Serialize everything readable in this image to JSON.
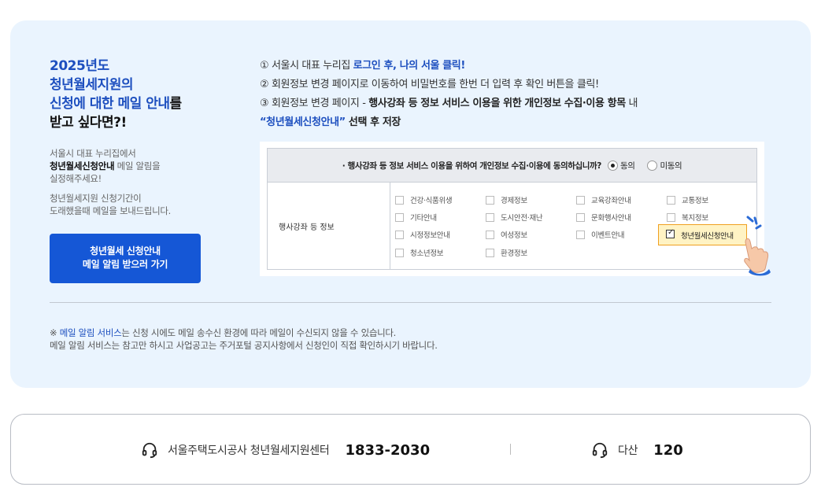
{
  "headline": {
    "line1": "2025년도",
    "line2": "청년월세지원의",
    "line3_blue": "신청에 대한 메일 안내",
    "line3_rest": "를",
    "line4": "받고 싶다면?!"
  },
  "desc1": {
    "line1": "서울시 대표 누리집에서",
    "bold": "청년월세신청안내",
    "line2_rest": " 메일 알림을",
    "line3": "실정해주세요!"
  },
  "desc2": {
    "line1": "청년월세지원 신청기간이",
    "line2": "도래했을때 메일을 보내드립니다."
  },
  "cta": {
    "line1": "청년월세 신청안내",
    "line2": "메일 알림 받으러 가기"
  },
  "steps": {
    "s1_pre": "① 서울시 대표 누리집 ",
    "s1_blue": "로그인 후, 나의 서울 클릭!",
    "s2": "② 회원정보 변경 페이지로 이동하여 비밀번호를 한번 더 입력 후 확인 버튼을 클릭!",
    "s3_pre": "③ 회원정보 변경 페이지 - ",
    "s3_bold": "행사강좌 등 정보 서비스 이용을 위한 개인정보 수집·이용 항목",
    "s3_post": " 내",
    "s4_blue": "“청년월세신청안내”",
    "s4_post": " 선택 후 저장"
  },
  "form": {
    "question": "· 행사강좌 등 정보 서비스 이용을 위하여 개인정보 수집·이용에 동의하십니까?",
    "agree": "동의",
    "disagree": "미동의",
    "row_label": "행사강좌 등 정보",
    "options": [
      "건강·식품위생",
      "경제정보",
      "교육강좌안내",
      "교통정보",
      "기타안내",
      "도시안전·재난",
      "문화행사안내",
      "복지정보",
      "시정정보안내",
      "여성정보",
      "이벤트안내",
      "청소년정보",
      "환경정보"
    ],
    "selected": "청년월세신청안내"
  },
  "note": {
    "prefix": "※ ",
    "blue": "메일 알림 서비스",
    "line1_rest": "는 신청 시에도 메일 송수신 환경에 따라 메일이 수신되지 않을 수 있습니다.",
    "line2": "메일 알림 서비스는 참고만 하시고 사업공고는 주거포털 공지사항에서 신청인이 직접 확인하시기 바랍니다."
  },
  "contact": {
    "label1": "서울주택도시공사 청년월세지원센터",
    "num1": "1833-2030",
    "label2": "다산",
    "num2": "120"
  },
  "colors": {
    "panel_bg": "#eaf4fe",
    "accent_blue": "#1d4fbf",
    "button_blue": "#1557d6"
  }
}
